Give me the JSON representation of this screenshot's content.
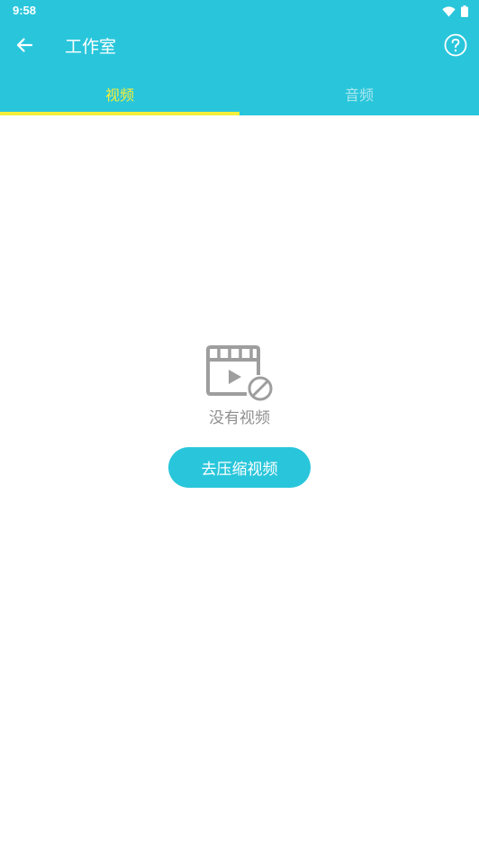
{
  "status_bar": {
    "time": "9:58",
    "icons": [
      "wifi-icon",
      "battery-icon"
    ]
  },
  "toolbar": {
    "back_icon": "arrow-left-icon",
    "title": "工作室",
    "help_icon": "help-circle-icon"
  },
  "tabs": [
    {
      "label": "视频",
      "active": true
    },
    {
      "label": "音频",
      "active": false
    }
  ],
  "empty_state": {
    "icon": "video-disabled-icon",
    "message": "没有视频",
    "action_label": "去压缩视频"
  },
  "colors": {
    "primary": "#29C6DB",
    "tab_active": "#F5EE3A",
    "tab_inactive": "#a9e6ee",
    "empty_text": "#8f8f8f",
    "icon_gray": "#9e9e9e"
  }
}
